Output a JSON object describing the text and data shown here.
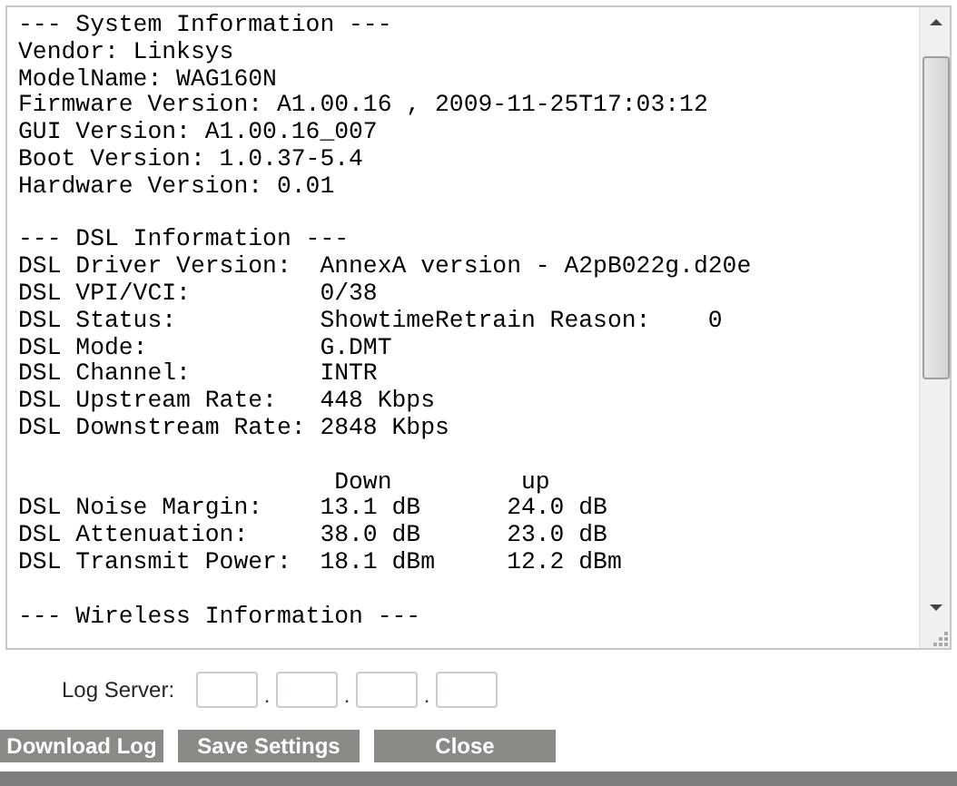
{
  "log_view": {
    "sections": [
      {
        "lines": [
          "--- System Information ---",
          "Vendor: Linksys",
          "ModelName: WAG160N",
          "Firmware Version: A1.00.16 , 2009-11-25T17:03:12",
          "GUI Version: A1.00.16_007",
          "Boot Version: 1.0.37-5.4",
          "Hardware Version: 0.01"
        ]
      },
      {
        "lines": [
          "--- DSL Information ---",
          "DSL Driver Version:  AnnexA version - A2pB022g.d20e",
          "DSL VPI/VCI:         0/38",
          "DSL Status:          ShowtimeRetrain Reason:    0",
          "DSL Mode:            G.DMT",
          "DSL Channel:         INTR",
          "DSL Upstream Rate:   448 Kbps",
          "DSL Downstream Rate: 2848 Kbps"
        ]
      },
      {
        "lines": [
          "                      Down         up",
          "DSL Noise Margin:    13.1 dB      24.0 dB",
          "DSL Attenuation:     38.0 dB      23.0 dB",
          "DSL Transmit Power:  18.1 dBm     12.2 dBm"
        ]
      },
      {
        "lines": [
          "--- Wireless Information ---"
        ]
      }
    ]
  },
  "log_server": {
    "label": "Log Server:",
    "parts": [
      {
        "kind": "field"
      },
      {
        "kind": "dot",
        "text": "."
      },
      {
        "kind": "field"
      },
      {
        "kind": "dot",
        "text": "."
      },
      {
        "kind": "field"
      },
      {
        "kind": "dot",
        "text": "."
      },
      {
        "kind": "field"
      }
    ]
  },
  "buttons": [
    "Download Log",
    "Save Settings",
    "Close"
  ]
}
